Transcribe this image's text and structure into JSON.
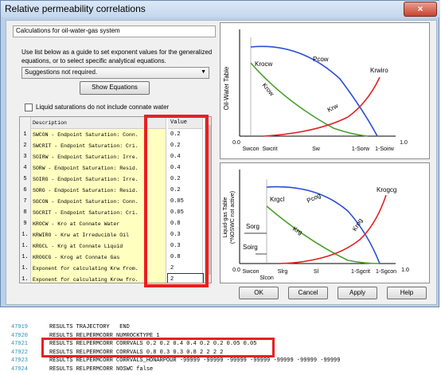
{
  "window": {
    "title": "Relative permeability correlations",
    "close_label": "×"
  },
  "system_description": "Calculations for oil-water-gas system",
  "instructions": "Use list below as a guide to set exponent values for the generalized equations, or to select specific analytical equations.",
  "suggestion_combo": {
    "value": "Suggestions not required."
  },
  "show_equations_label": "Show Equations",
  "liquid_checkbox": {
    "label": "Liquid saturations do not include connate water",
    "checked": false
  },
  "grid": {
    "headers": {
      "description": "Description",
      "value": "Value"
    },
    "rows": [
      {
        "num": "1",
        "desc": "SWCON - Endpoint Saturation: Conn.",
        "value": "0.2"
      },
      {
        "num": "2",
        "desc": "SWCRIT - Endpoint Saturation: Cri.",
        "value": "0.2"
      },
      {
        "num": "3",
        "desc": "SOIRW - Endpoint Saturation: Irre.",
        "value": "0.4"
      },
      {
        "num": "4",
        "desc": "SORW - Endpoint Saturation: Resid.",
        "value": "0.4"
      },
      {
        "num": "5",
        "desc": "SOIRG - Endpoint Saturation: Irre.",
        "value": "0.2"
      },
      {
        "num": "6",
        "desc": "SORG - Endpoint Saturation: Resid.",
        "value": "0.2"
      },
      {
        "num": "7",
        "desc": "SGCON - Endpoint Saturation: Conn.",
        "value": "0.05"
      },
      {
        "num": "8",
        "desc": "SGCRIT - Endpoint Saturation: Cri.",
        "value": "0.05"
      },
      {
        "num": "9",
        "desc": "KROCW - Kro at Connate Water",
        "value": "0.8"
      },
      {
        "num": "1.",
        "desc": "KRWIRO - Krw at Irreducible Oil",
        "value": "0.3"
      },
      {
        "num": "1.",
        "desc": "KRGCL - Krg at Connate Liquid",
        "value": "0.3"
      },
      {
        "num": "1.",
        "desc": "KROGCG - Krog at Connate Gas",
        "value": "0.8"
      },
      {
        "num": "1.",
        "desc": "Exponent for calculating Krw from.",
        "value": "2"
      },
      {
        "num": "1.",
        "desc": "Exponent for calculating Krow fro.",
        "value": "2"
      }
    ]
  },
  "ow_plot": {
    "ylabel": "Oil-Water Table",
    "curves": [
      "Krocw",
      "Pcow",
      "Krwiro",
      "Krow",
      "Krw"
    ],
    "x_ticks": [
      "0.0",
      "Swcon",
      "Swcrit",
      "Sw",
      "1-Sorw",
      "1-Soirw",
      "1.0"
    ]
  },
  "lg_plot": {
    "ylabel": "Liquid-gas Table",
    "ylabel2": "(*NOSWC not active)",
    "curves": [
      "Krgcl",
      "Pcog",
      "Krogcg",
      "Krg",
      "Krog",
      "Sorg",
      "Soirg"
    ],
    "x_ticks": [
      "0.0",
      "Swcon",
      "Slcon",
      "Slrg",
      "Sl",
      "1-Sgcrit",
      "1-Sgcon",
      "1.0"
    ]
  },
  "buttons": {
    "ok": "OK",
    "cancel": "Cancel",
    "apply": "Apply",
    "help": "Help"
  },
  "code_lines": [
    {
      "num": "47919",
      "text": "RESULTS TRAJECTORY   END"
    },
    {
      "num": "47920",
      "text": "RESULTS RELPERMCORR NUMROCKTYPE 1"
    },
    {
      "num": "47921",
      "text": "RESULTS RELPERMCORR CORRVALS 0.2 0.2 0.4 0.4 0.2 0.2 0.05 0.05"
    },
    {
      "num": "47922",
      "text": "RESULTS RELPERMCORR CORRVALS 0.8 0.3 0.3 0.8 2 2 2 2"
    },
    {
      "num": "47923",
      "text": "RESULTS RELPERMCORR CORRVALS_HONARPOUR -99999 -99999 -99999 -99999 -99999 -99999 -99999"
    },
    {
      "num": "47924",
      "text": "RESULTS RELPERMCORR NOSWC false"
    }
  ],
  "colors": {
    "blue_curve": "#2a4dd8",
    "green_curve": "#4aa02c",
    "red_curve": "#e32222",
    "highlight": "#e82020"
  }
}
